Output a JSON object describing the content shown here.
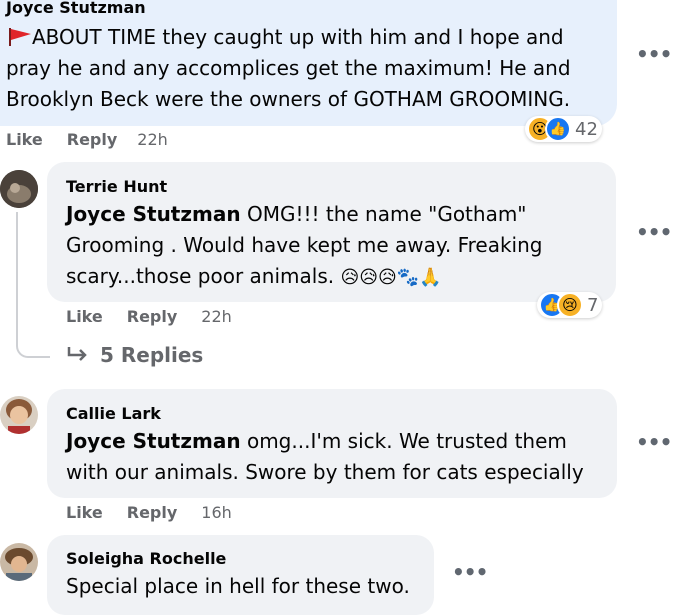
{
  "comments": [
    {
      "author": "Joyce Stutzman",
      "flag_icon": "red-flag-icon",
      "text_lines": [
        "ABOUT TIME they caught up with him and I hope and",
        "pray he and any accomplices get the maximum! He and",
        "Brooklyn Beck were the owners of GOTHAM GROOMING."
      ],
      "like": "Like",
      "reply": "Reply",
      "time": "22h",
      "reaction_count": "42"
    },
    {
      "author": "Terrie Hunt",
      "mention": "Joyce Stutzman",
      "text_line1": "OMG!!! the name \"Gotham\"",
      "text_line2": "Grooming . Would have kept me away. Freaking",
      "text_line3": "scary...those poor animals.",
      "emojis": "😥😥😥🐾🙏",
      "like": "Like",
      "reply": "Reply",
      "time": "22h",
      "reaction_count": "7",
      "replies_label": "5 Replies"
    },
    {
      "author": "Callie Lark",
      "mention": "Joyce Stutzman",
      "text_line1": "omg...I'm sick. We trusted them",
      "text_line2": "with our animals. Swore by them for cats especially",
      "like": "Like",
      "reply": "Reply",
      "time": "16h"
    },
    {
      "author": "Soleigha Rochelle",
      "text_line1": "Special place in hell for these two."
    }
  ],
  "more_icon": "•••",
  "colors": {
    "bubble": "#f0f2f5",
    "highlight_bubble": "#e7f0fc",
    "like_blue": "#1877f2",
    "meta_gray": "#65676b"
  }
}
